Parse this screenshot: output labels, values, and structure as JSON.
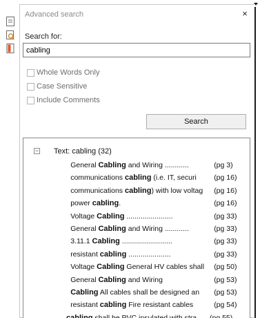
{
  "panel": {
    "title": "Advanced search",
    "close_label": "×"
  },
  "search": {
    "label": "Search for:",
    "value": "cabling",
    "button_label": "Search"
  },
  "options": [
    {
      "label": "Whole Words Only",
      "checked": false
    },
    {
      "label": "Case Sensitive",
      "checked": false
    },
    {
      "label": "Include Comments",
      "checked": false
    }
  ],
  "results": {
    "group_label": "Text: cabling  (32)",
    "toggle_label": "−",
    "rows": [
      {
        "pre": "General ",
        "term": "Cabling",
        "post": " and Wiring ............",
        "page": "(pg 3)",
        "indent": 22
      },
      {
        "pre": "communications ",
        "term": "cabling",
        "post": " (i.e. IT, securi",
        "page": "(pg 16)",
        "indent": 22
      },
      {
        "pre": "communications ",
        "term": "cabling",
        "post": ") with low voltag",
        "page": "(pg 16)",
        "indent": 22
      },
      {
        "pre": "power ",
        "term": "cabling",
        "post": ".",
        "page": "(pg 16)",
        "indent": 22
      },
      {
        "pre": "Voltage ",
        "term": "Cabling",
        "post": " .......................",
        "page": "(pg 33)",
        "indent": 22
      },
      {
        "pre": "General ",
        "term": "Cabling",
        "post": " and Wiring ............",
        "page": "(pg 33)",
        "indent": 22
      },
      {
        "pre": "3.11.1 ",
        "term": "Cabling",
        "post": " .........................",
        "page": "(pg 33)",
        "indent": 22
      },
      {
        "pre": "resistant ",
        "term": "cabling",
        "post": " .....................",
        "page": "(pg 33)",
        "indent": 22
      },
      {
        "pre": "Voltage ",
        "term": "Cabling",
        "post": " General HV cables shall",
        "page": "(pg 50)",
        "indent": 22
      },
      {
        "pre": "General ",
        "term": "Cabling",
        "post": " and Wiring",
        "page": "(pg 53)",
        "indent": 22
      },
      {
        "pre": "",
        "term": "Cabling",
        "post": " All cables shall be designed an",
        "page": "(pg 53)",
        "indent": 22
      },
      {
        "pre": "resistant ",
        "term": "cabling",
        "post": " Fire resistant cables",
        "page": "(pg 54)",
        "indent": 22
      },
      {
        "pre": "",
        "term": "cabling",
        "post": " shall be PVC insulated with stra",
        "page": "(pg 55)",
        "indent": 20
      }
    ]
  },
  "icons": {
    "tool1": "page-icon",
    "tool2": "search-document-icon",
    "tool3": "bookmark-icon"
  },
  "colors": {
    "bookmark": "#e0572a",
    "search_glass": "#d98a2b"
  }
}
